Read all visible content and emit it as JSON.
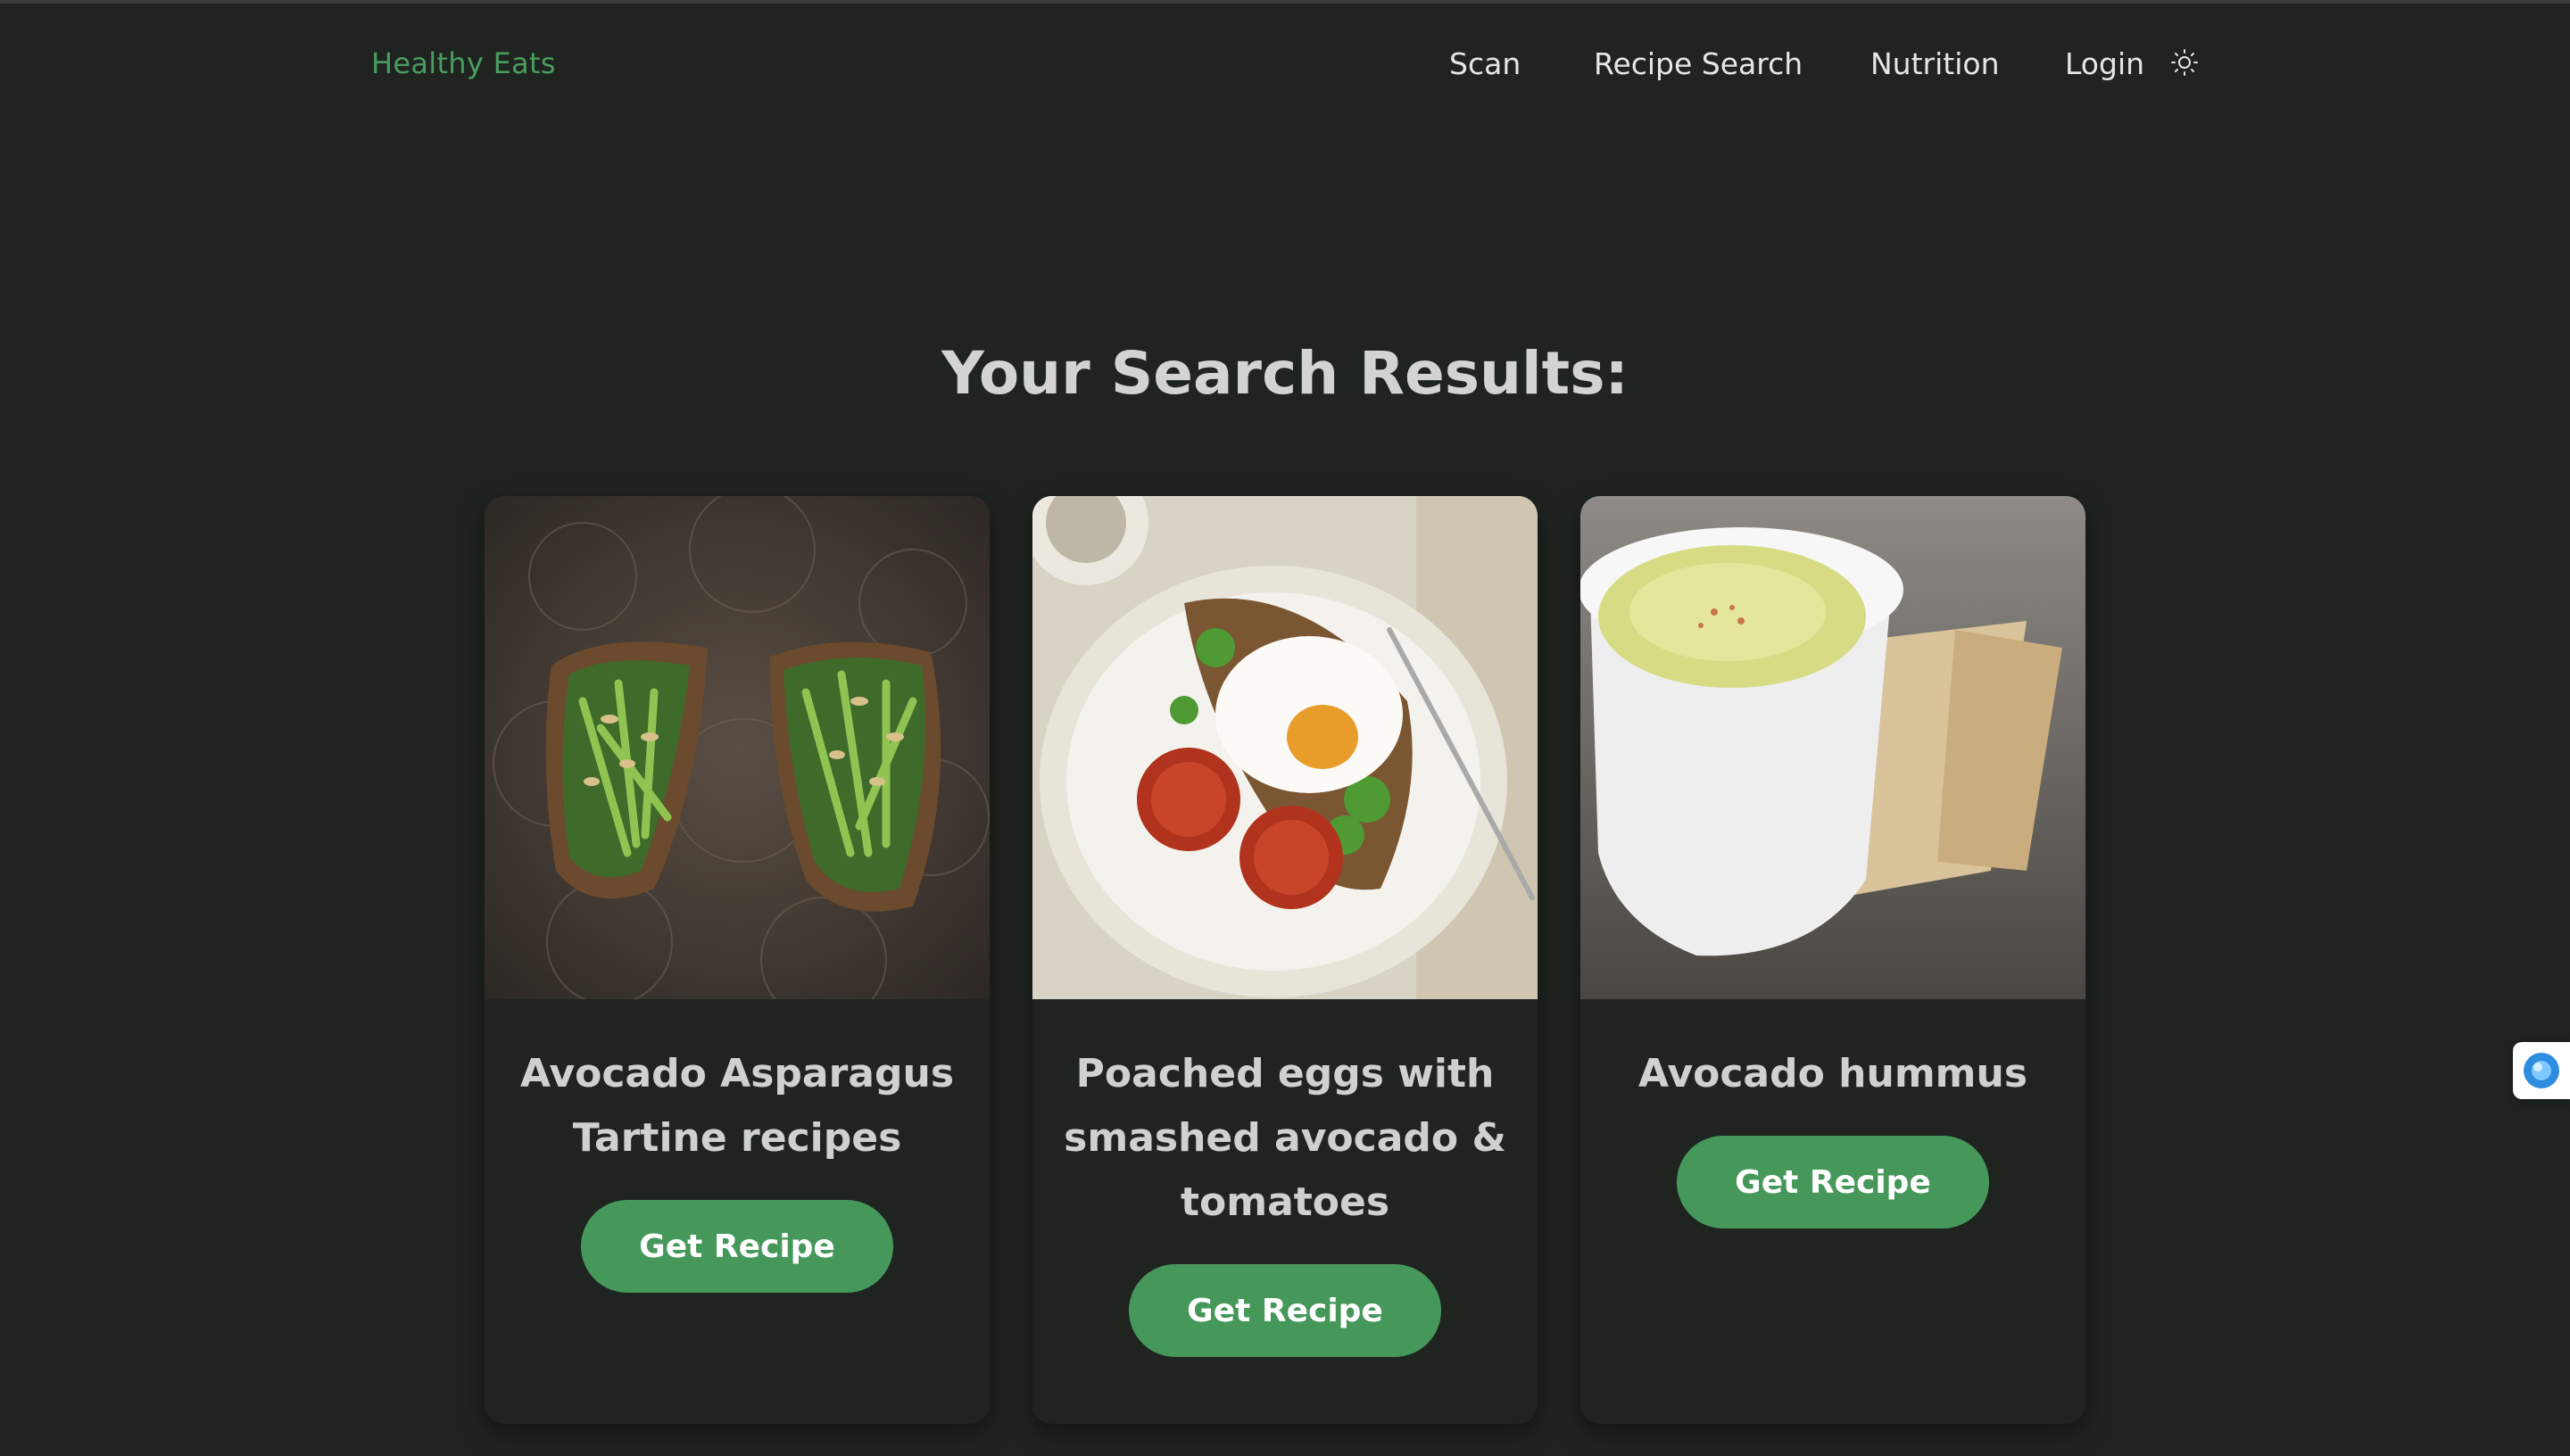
{
  "nav": {
    "brand": "Healthy Eats",
    "links": [
      "Scan",
      "Recipe Search",
      "Nutrition",
      "Login"
    ],
    "theme_toggle_icon": "sun-icon"
  },
  "results": {
    "heading": "Your Search Results:"
  },
  "recipes": [
    {
      "title": "Avocado Asparagus Tartine recipes",
      "button": "Get Recipe",
      "image": "asparagus-tartine-photo"
    },
    {
      "title": "Poached eggs with smashed avocado & tomatoes",
      "button": "Get Recipe",
      "image": "poached-eggs-photo"
    },
    {
      "title": "Avocado hummus",
      "button": "Get Recipe",
      "image": "avocado-hummus-photo"
    }
  ],
  "colors": {
    "background": "#1f2421",
    "accent": "#45985a",
    "brand": "#4a9d5e",
    "text": "#d3d3d3"
  }
}
